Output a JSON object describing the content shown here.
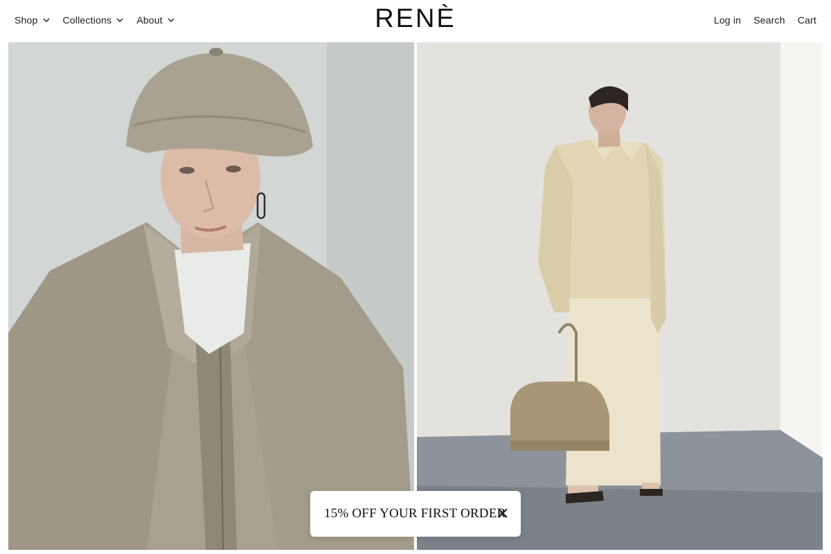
{
  "header": {
    "logo": "RENÈ",
    "nav_left": [
      {
        "label": "Shop",
        "icon": "chevron-down-icon"
      },
      {
        "label": "Collections",
        "icon": "chevron-down-icon"
      },
      {
        "label": "About",
        "icon": "chevron-down-icon"
      }
    ],
    "nav_right": [
      {
        "label": "Log in"
      },
      {
        "label": "Search"
      },
      {
        "label": "Cart"
      }
    ]
  },
  "hero": {
    "images": [
      {
        "name": "model-in-textured-jacket-and-cap"
      },
      {
        "name": "model-in-cream-shirt-with-bag"
      }
    ]
  },
  "promo": {
    "text": "15% OFF YOUR FIRST ORDER",
    "close_icon": "close-icon"
  }
}
